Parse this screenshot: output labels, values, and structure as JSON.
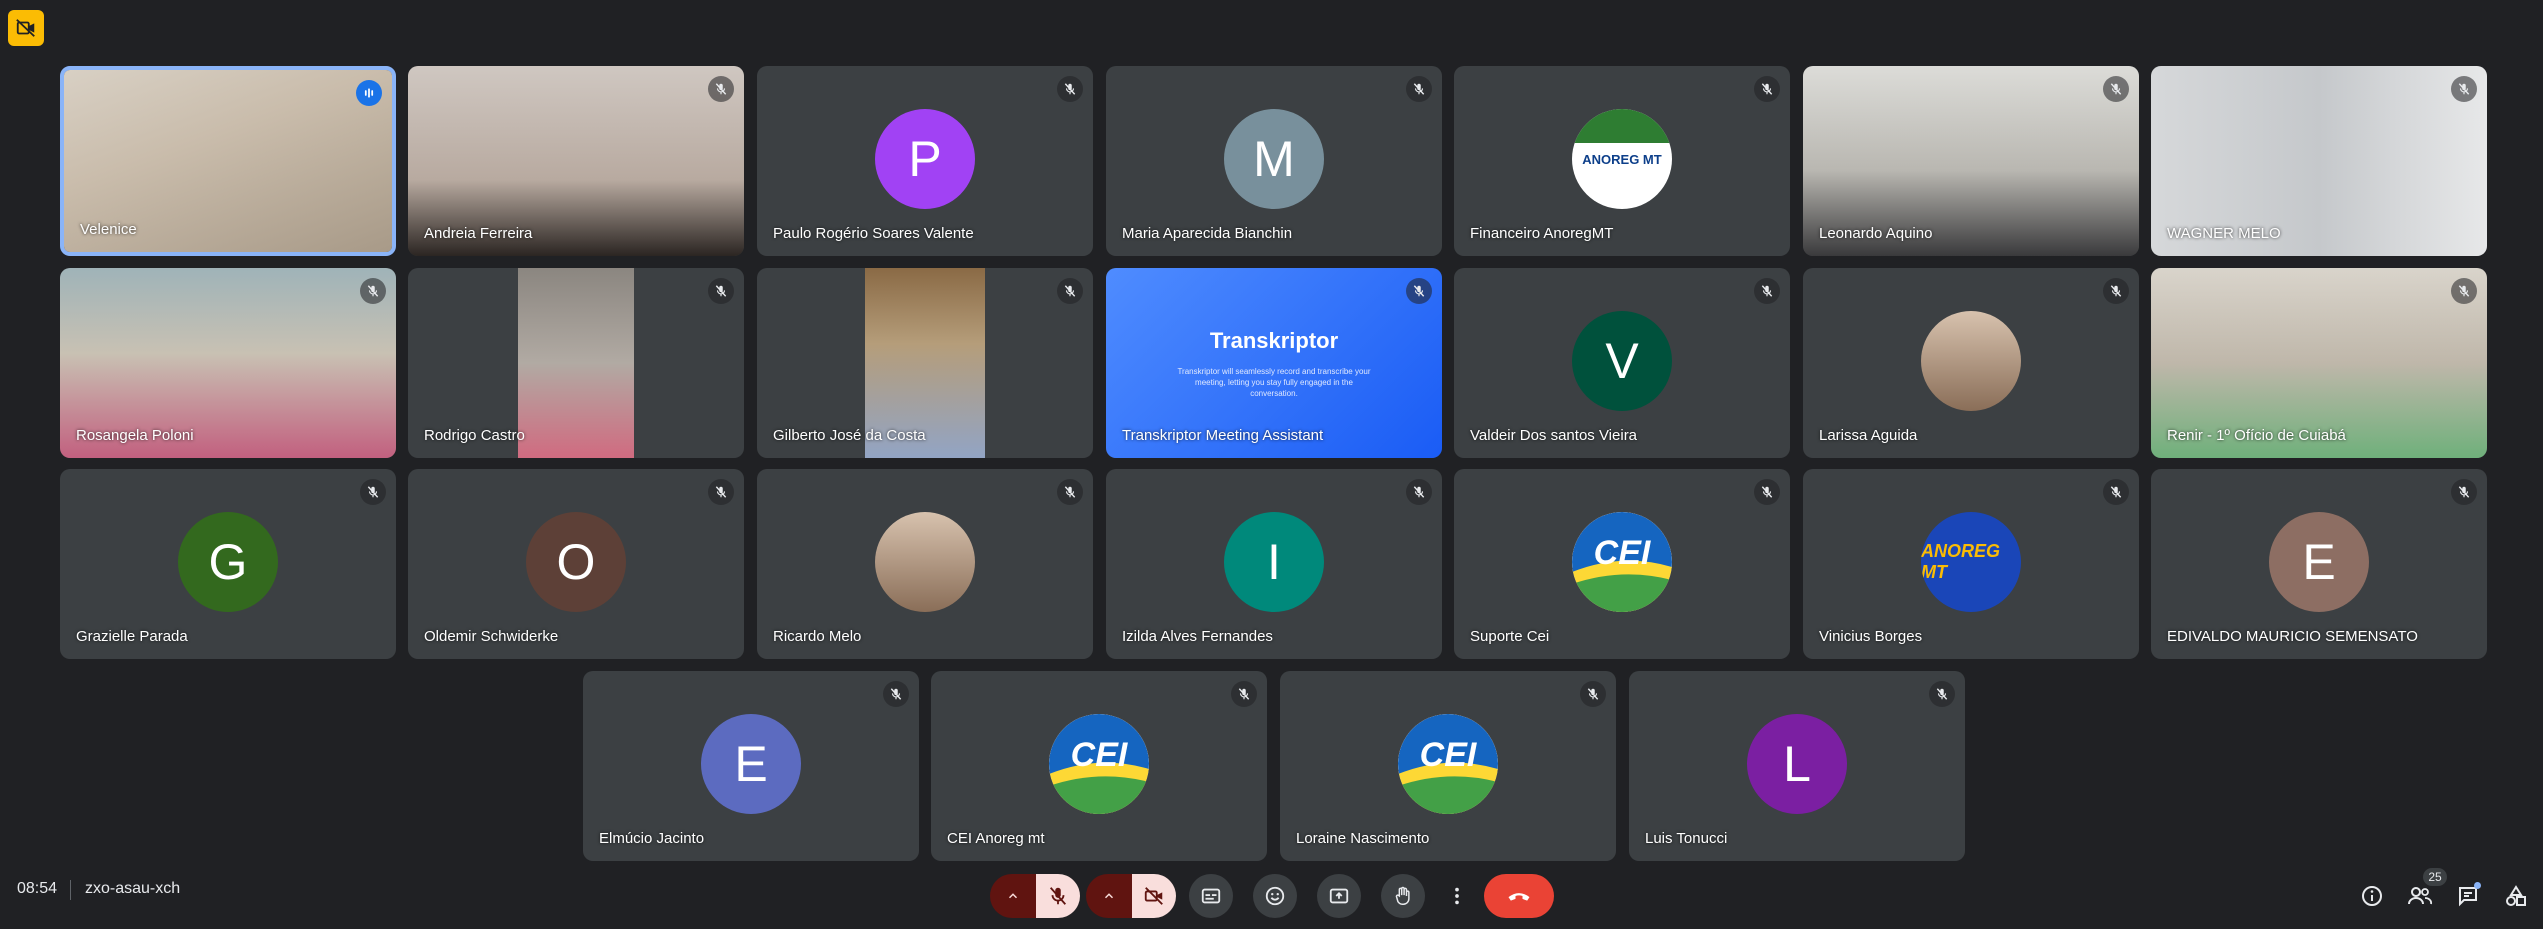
{
  "meeting": {
    "time": "08:54",
    "code": "zxo-asau-xch"
  },
  "colors": {
    "background": "#202124",
    "tile": "#3c4043",
    "active_border": "#8ab4f8",
    "end_call": "#ea4335",
    "badge": "#fbbc04"
  },
  "participants": [
    {
      "name": "Velenice",
      "kind": "video",
      "speaking": true
    },
    {
      "name": "Andreia Ferreira",
      "kind": "video"
    },
    {
      "name": "Paulo Rogério Soares Valente",
      "kind": "initial",
      "initial": "P",
      "color": "#a142f4"
    },
    {
      "name": "Maria Aparecida Bianchin",
      "kind": "initial",
      "initial": "M",
      "color": "#78909c"
    },
    {
      "name": "Financeiro AnoregMT",
      "kind": "logo",
      "logo_text": "ANOREG MT"
    },
    {
      "name": "Leonardo Aquino",
      "kind": "video"
    },
    {
      "name": "WAGNER MELO",
      "kind": "video"
    },
    {
      "name": "Rosangela Poloni",
      "kind": "video"
    },
    {
      "name": "Rodrigo Castro",
      "kind": "video"
    },
    {
      "name": "Gilberto José da Costa",
      "kind": "video"
    },
    {
      "name": "Transkriptor Meeting Assistant",
      "kind": "transkriptor",
      "title": "Transkriptor",
      "subtitle": "Transkriptor will seamlessly record and transcribe your meeting, letting you stay fully engaged in the conversation."
    },
    {
      "name": "Valdeir Dos santos Vieira",
      "kind": "initial",
      "initial": "V",
      "color": "#00513c"
    },
    {
      "name": "Larissa Aguida",
      "kind": "photo"
    },
    {
      "name": "Renir - 1º Ofício de Cuiabá",
      "kind": "video"
    },
    {
      "name": "Grazielle Parada",
      "kind": "initial",
      "initial": "G",
      "color": "#33691e"
    },
    {
      "name": "Oldemir Schwiderke",
      "kind": "initial",
      "initial": "O",
      "color": "#5d4037"
    },
    {
      "name": "Ricardo Melo",
      "kind": "photo"
    },
    {
      "name": "Izilda Alves Fernandes",
      "kind": "initial",
      "initial": "I",
      "color": "#00897b"
    },
    {
      "name": "Suporte Cei",
      "kind": "cei",
      "logo_text": "CEI"
    },
    {
      "name": "Vinicius Borges",
      "kind": "anoreg",
      "logo_text": "ANOREG MT"
    },
    {
      "name": "EDIVALDO MAURICIO SEMENSATO",
      "kind": "initial",
      "initial": "E",
      "color": "#8d6e63"
    },
    {
      "name": "Elmúcio Jacinto",
      "kind": "initial",
      "initial": "E",
      "color": "#5c6bc0"
    },
    {
      "name": "CEI Anoreg mt",
      "kind": "cei",
      "logo_text": "CEI"
    },
    {
      "name": "Loraine Nascimento",
      "kind": "cei",
      "logo_text": "CEI"
    },
    {
      "name": "Luis Tonucci",
      "kind": "initial",
      "initial": "L",
      "color": "#7b1fa2"
    }
  ],
  "toolbar": {
    "items": [
      "mic-options-icon",
      "mic-off-icon",
      "camera-options-icon",
      "camera-off-icon",
      "captions-icon",
      "emoji-icon",
      "present-icon",
      "raise-hand-icon",
      "more-options-icon",
      "end-call-icon"
    ]
  },
  "right_panel": {
    "people_count": "25"
  }
}
